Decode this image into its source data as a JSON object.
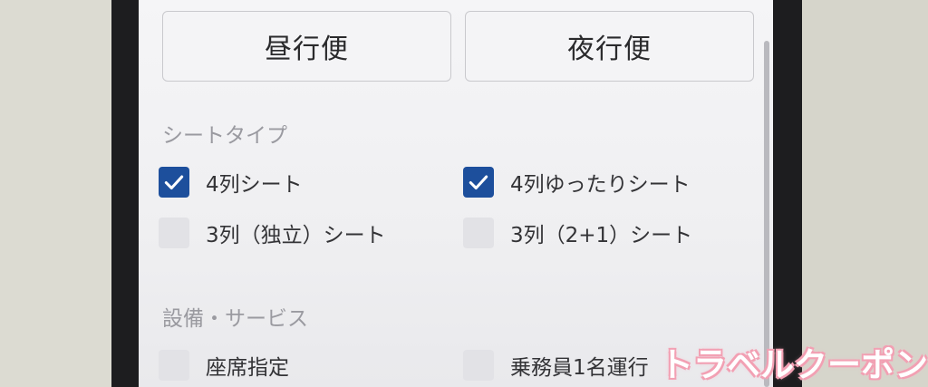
{
  "trip_buttons": {
    "day_label": "昼行便",
    "night_label": "夜行便"
  },
  "seat_type": {
    "title": "シートタイプ",
    "options": [
      {
        "label": "4列シート",
        "checked": true
      },
      {
        "label": "4列ゆったりシート",
        "checked": true
      },
      {
        "label": "3列（独立）シート",
        "checked": false
      },
      {
        "label": "3列（2+1）シート",
        "checked": false
      }
    ]
  },
  "facilities": {
    "title": "設備・サービス",
    "options": [
      {
        "label": "座席指定",
        "checked": false
      },
      {
        "label": "乗務員1名運行",
        "checked": false
      }
    ]
  },
  "colors": {
    "checkbox_checked": "#1d4f9c",
    "checkbox_unchecked": "#e2e2e6",
    "watermark_outline": "#f2a0b3"
  },
  "watermark": "トラベルクーポン"
}
